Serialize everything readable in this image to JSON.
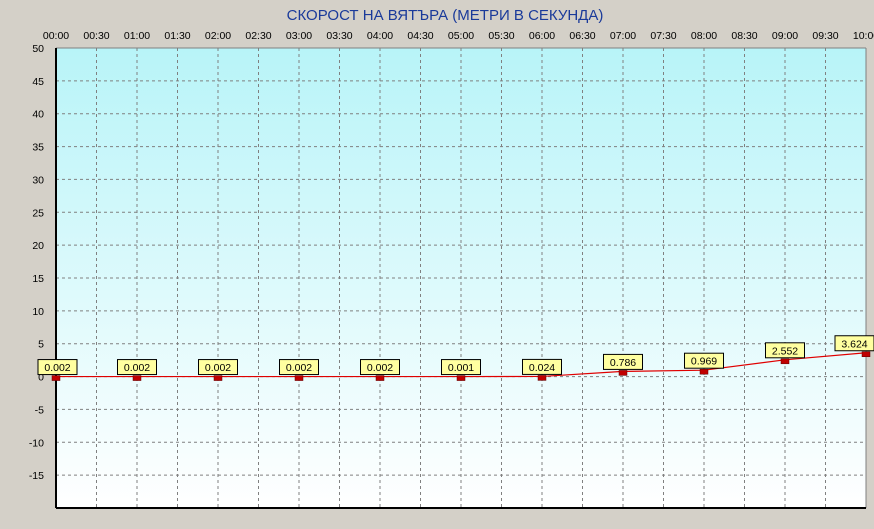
{
  "chart_data": {
    "type": "line",
    "title": "СКОРОСТ НА ВЯТЪРА (МЕТРИ В СЕКУНДА)",
    "xlabel": "",
    "ylabel": "",
    "x_ticks": [
      "00:00",
      "00:30",
      "01:00",
      "01:30",
      "02:00",
      "02:30",
      "03:00",
      "03:30",
      "04:00",
      "04:30",
      "05:00",
      "05:30",
      "06:00",
      "06:30",
      "07:00",
      "07:30",
      "08:00",
      "08:30",
      "09:00",
      "09:30",
      "10:00"
    ],
    "y_ticks": [
      "50",
      "45",
      "40",
      "35",
      "30",
      "25",
      "20",
      "15",
      "10",
      "5",
      "0",
      "-5",
      "-10",
      "-15"
    ],
    "ylim": [
      -20,
      50
    ],
    "grid": true,
    "series": [
      {
        "x": [
          "00:00",
          "01:00",
          "02:00",
          "03:00",
          "04:00",
          "05:00",
          "06:00",
          "07:00",
          "08:00",
          "09:00",
          "10:00"
        ],
        "values": [
          0.002,
          0.002,
          0.002,
          0.002,
          0.002,
          0.001,
          0.024,
          0.786,
          0.969,
          2.552,
          3.624
        ],
        "labels": [
          "0.002",
          "0.002",
          "0.002",
          "0.002",
          "0.002",
          "0.001",
          "0.024",
          "0.786",
          "0.969",
          "2.552",
          "3.624"
        ]
      }
    ],
    "colors": {
      "line": "#e00000",
      "marker": "#c00000",
      "label_bg": "#ffffa0",
      "grid": "#808080",
      "plot_bg_top": "#b8f4f8",
      "plot_bg_bottom": "#ffffff",
      "frame_bg": "#d4d0c8",
      "title": "#1a3a9a"
    }
  }
}
